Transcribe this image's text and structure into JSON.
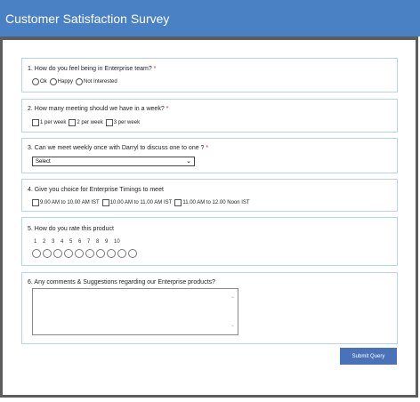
{
  "header": {
    "title": "Customer Satisfaction Survey"
  },
  "questions": [
    {
      "number": "1.",
      "text": "How do you feel being in Enterprise team?",
      "required_mark": "*",
      "type": "radio",
      "options": [
        "Ok",
        "Happy",
        "Not Interested"
      ]
    },
    {
      "number": "2.",
      "text": "How many meeting should we have in a week?",
      "required_mark": "*",
      "type": "checkbox",
      "options": [
        "1 per week",
        "2 per week",
        "3 per week"
      ]
    },
    {
      "number": "3.",
      "text": "Can we meet weekly once with Darryl to discuss one to one ?",
      "required_mark": "*",
      "type": "select",
      "selected": "Select"
    },
    {
      "number": "4.",
      "text": "Give you choice for Enterprise Timings to meet",
      "type": "checkbox",
      "options": [
        "9.00 AM to 10.00 AM IST",
        "10.00 AM to 11.00 AM IST",
        "11.00 AM to 12.00 Noon IST"
      ]
    },
    {
      "number": "5.",
      "text": "How do you rate this product",
      "type": "scale",
      "scale": [
        "1",
        "2",
        "3",
        "4",
        "5",
        "6",
        "7",
        "8",
        "9",
        "10"
      ]
    },
    {
      "number": "6.",
      "text": "Any comments & Suggestions regarding our Enterprise products?",
      "type": "textarea"
    }
  ],
  "submit": {
    "label": "Submit Query"
  },
  "icons": {
    "select_arrow": "chevron-down-icon",
    "scroll_up": "chevron-up-icon",
    "scroll_down": "chevron-down-icon"
  },
  "colors": {
    "header_bg": "#4a80c4",
    "panel_border": "#b7d3ec",
    "required": "#e02020",
    "submit_bg": "#4a72b8"
  }
}
